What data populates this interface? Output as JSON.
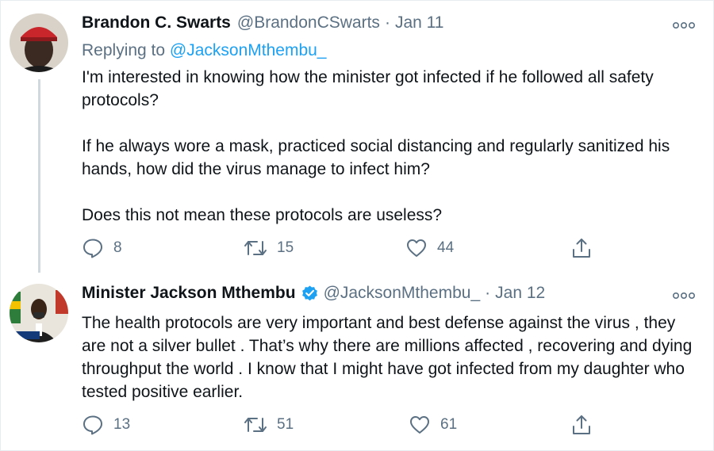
{
  "tweets": [
    {
      "name": "Brandon C. Swarts",
      "handle": "@BrandonCSwarts",
      "separator": "·",
      "date": "Jan 11",
      "replying_label": "Replying to",
      "replying_to": "@JacksonMthembu_",
      "paragraphs": [
        "I'm interested in knowing how the minister got infected if he followed all safety protocols?",
        "If he always wore a mask, practiced social distancing and regularly sanitized his hands, how did the virus manage to infect him?",
        "Does this not mean these protocols are useless?"
      ],
      "replies": "8",
      "retweets": "15",
      "likes": "44"
    },
    {
      "name": "Minister Jackson Mthembu",
      "verified": true,
      "handle": "@JacksonMthembu_",
      "separator": "·",
      "date": "Jan 12",
      "text": "The health protocols are very important and best defense against the virus , they are not a silver bullet . That’s why there are millions affected , recovering and dying throughput the world . I know that I might have got infected from my daughter who tested positive earlier.",
      "replies": "13",
      "retweets": "51",
      "likes": "61"
    }
  ],
  "colors": {
    "text": "#0f1419",
    "muted": "#5b7083",
    "link": "#1da1f2",
    "verified": "#1da1f2",
    "thread_line": "#cfd9de"
  },
  "icons": [
    "reply-icon",
    "retweet-icon",
    "like-icon",
    "share-icon",
    "more-icon",
    "verified-badge-icon"
  ]
}
